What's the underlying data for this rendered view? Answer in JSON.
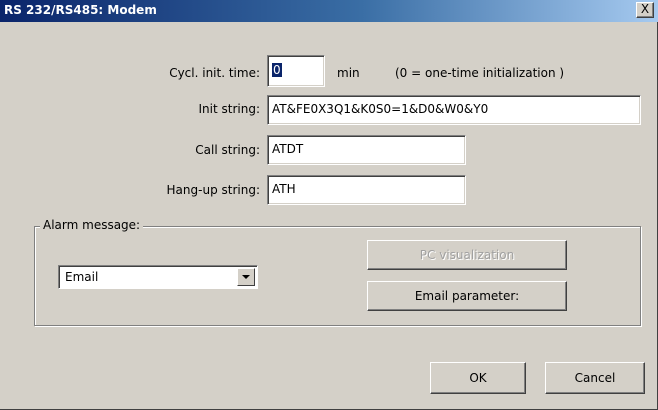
{
  "window": {
    "title": "RS 232/RS485: Modem",
    "close_glyph": "X"
  },
  "form": {
    "cycl_init": {
      "label": "Cycl. init. time:",
      "value": "0",
      "unit": "min",
      "note": "(0 = one-time initialization )"
    },
    "init_string": {
      "label": "Init string:",
      "value": "AT&FE0X3Q1&K0S0=1&D0&W0&Y0"
    },
    "call_string": {
      "label": "Call string:",
      "value": "ATDT"
    },
    "hangup_string": {
      "label": "Hang-up string:",
      "value": "ATH"
    }
  },
  "alarm": {
    "legend": "Alarm message:",
    "selected": "Email",
    "pc_visualization_label": "PC visualization",
    "email_parameter_label": "Email parameter:"
  },
  "buttons": {
    "ok": "OK",
    "cancel": "Cancel"
  },
  "colors": {
    "titlebar_start": "#0a246a",
    "titlebar_end": "#a6caf0",
    "dialog_bg": "#d4d0c8"
  }
}
